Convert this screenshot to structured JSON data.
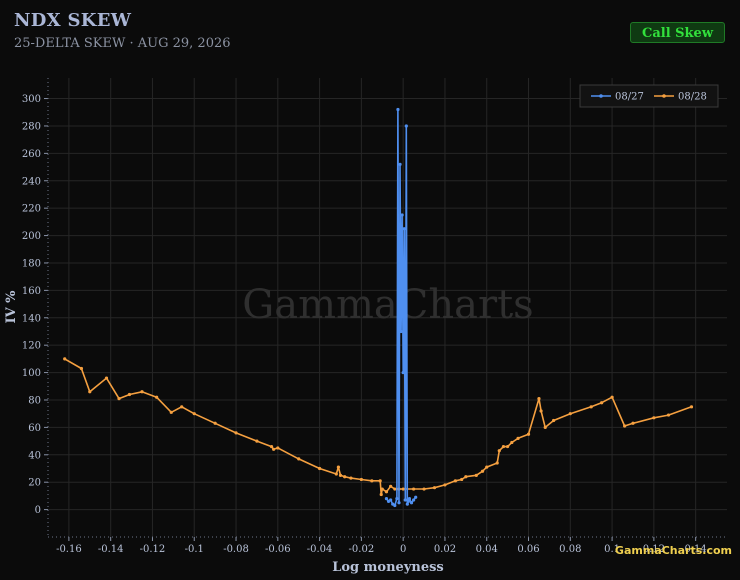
{
  "header": {
    "title": "NDX SKEW",
    "subtitle": "25-DELTA SKEW · AUG 29, 2026",
    "toggle_label": "Call Skew"
  },
  "watermark": "GammaCharts",
  "brand": "GammaCharts.com",
  "colors": {
    "background": "#0b0b0b",
    "grid": "#262626",
    "series_0827": "#4f8ff0",
    "series_0828": "#f5a040",
    "toggle_text": "#32e03c"
  },
  "chart_data": {
    "type": "line",
    "xlabel": "Log moneyness",
    "ylabel": "IV %",
    "xlim": [
      -0.17,
      0.155
    ],
    "ylim": [
      -20,
      315
    ],
    "xticks": [
      -0.16,
      -0.14,
      -0.12,
      -0.1,
      -0.08,
      -0.06,
      -0.04,
      -0.02,
      0,
      0.02,
      0.04,
      0.06,
      0.08,
      0.1,
      0.12,
      0.14
    ],
    "xtick_labels": [
      "-0.16",
      "-0.14",
      "-0.12",
      "-0.1",
      "-0.08",
      "-0.06",
      "-0.04",
      "-0.02",
      "0",
      "0.02",
      "0.04",
      "0.06",
      "0.08",
      "0.1",
      "0.12",
      "0.14"
    ],
    "yticks": [
      0,
      20,
      40,
      60,
      80,
      100,
      120,
      140,
      160,
      180,
      200,
      220,
      240,
      260,
      280,
      300
    ],
    "grid": true,
    "legend_position": "top-right",
    "series": [
      {
        "name": "08/27",
        "x": [
          -0.008,
          -0.007,
          -0.006,
          -0.005,
          -0.004,
          -0.003,
          -0.0025,
          -0.002,
          -0.0015,
          -0.001,
          -0.0005,
          0,
          0.0005,
          0.001,
          0.0015,
          0.002,
          0.0025,
          0.003,
          0.004,
          0.005,
          0.006
        ],
        "y": [
          8,
          6,
          7,
          4,
          3,
          8,
          292,
          5,
          252,
          130,
          215,
          100,
          205,
          7,
          280,
          4,
          6,
          8,
          5,
          7,
          9
        ]
      },
      {
        "name": "08/28",
        "x": [
          -0.162,
          -0.154,
          -0.15,
          -0.142,
          -0.136,
          -0.131,
          -0.125,
          -0.118,
          -0.111,
          -0.106,
          -0.1,
          -0.09,
          -0.08,
          -0.07,
          -0.063,
          -0.062,
          -0.06,
          -0.05,
          -0.04,
          -0.032,
          -0.031,
          -0.03,
          -0.028,
          -0.025,
          -0.02,
          -0.015,
          -0.011,
          -0.0105,
          -0.01,
          -0.008,
          -0.006,
          -0.004,
          -0.002,
          0,
          0.005,
          0.01,
          0.015,
          0.02,
          0.025,
          0.028,
          0.03,
          0.035,
          0.038,
          0.04,
          0.045,
          0.046,
          0.048,
          0.05,
          0.052,
          0.055,
          0.06,
          0.065,
          0.066,
          0.068,
          0.072,
          0.08,
          0.09,
          0.095,
          0.1,
          0.106,
          0.11,
          0.12,
          0.127,
          0.138
        ],
        "y": [
          110,
          103,
          86,
          96,
          81,
          84,
          86,
          82,
          71,
          75,
          70,
          63,
          56,
          50,
          46,
          44,
          45,
          37,
          30,
          26,
          31,
          25,
          24,
          23,
          22,
          21,
          21,
          11,
          15,
          13,
          17,
          15,
          15,
          15,
          15,
          15,
          16,
          18,
          21,
          22,
          24,
          25,
          28,
          31,
          34,
          43,
          46,
          46,
          49,
          52,
          55,
          81,
          72,
          60,
          65,
          70,
          75,
          78,
          82,
          61,
          63,
          67,
          69,
          75
        ]
      }
    ]
  }
}
